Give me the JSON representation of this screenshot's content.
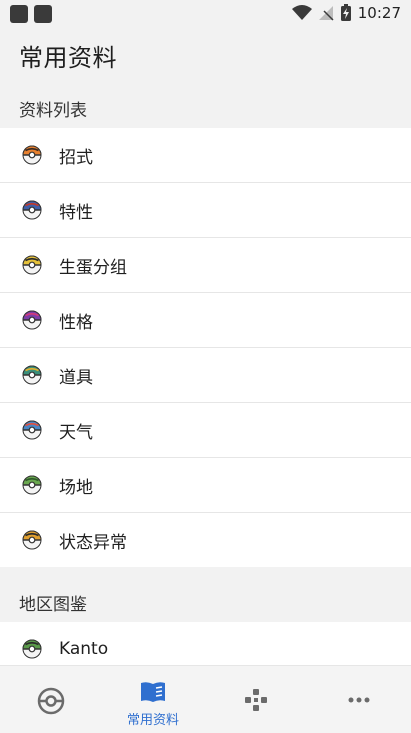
{
  "status": {
    "time": "10:27"
  },
  "title": "常用资料",
  "sections": [
    {
      "header": "资料列表",
      "items": [
        {
          "label": "招式",
          "ball": {
            "top": "#e8812f",
            "band": "#3a2a22"
          }
        },
        {
          "label": "特性",
          "ball": {
            "top": "#3f5fa8",
            "band": "#c0392b"
          }
        },
        {
          "label": "生蛋分组",
          "ball": {
            "top": "#e6c23a",
            "band": "#2b2b2b"
          }
        },
        {
          "label": "性格",
          "ball": {
            "top": "#7b3fa8",
            "band": "#d33a7a"
          }
        },
        {
          "label": "道具",
          "ball": {
            "top": "#3a8f7a",
            "band": "#e0b030"
          }
        },
        {
          "label": "天气",
          "ball": {
            "top": "#4a86c5",
            "band": "#e05040"
          }
        },
        {
          "label": "场地",
          "ball": {
            "top": "#6aa84f",
            "band": "#2f5a2a"
          }
        },
        {
          "label": "状态异常",
          "ball": {
            "top": "#e0a030",
            "band": "#2b2b2b"
          }
        }
      ]
    },
    {
      "header": "地区图鉴",
      "items": [
        {
          "label": "Kanto",
          "ball": {
            "top": "#5a9a4a",
            "band": "#2b2b2b"
          }
        }
      ]
    }
  ],
  "nav": [
    {
      "icon": "pokeball-icon",
      "label": ""
    },
    {
      "icon": "book-icon",
      "label": "常用资料",
      "active": true
    },
    {
      "icon": "gamepad-icon",
      "label": ""
    },
    {
      "icon": "more-icon",
      "label": ""
    }
  ],
  "colors": {
    "accent": "#2f6fcf",
    "background": "#f2f2f2",
    "list_background": "#ffffff"
  }
}
